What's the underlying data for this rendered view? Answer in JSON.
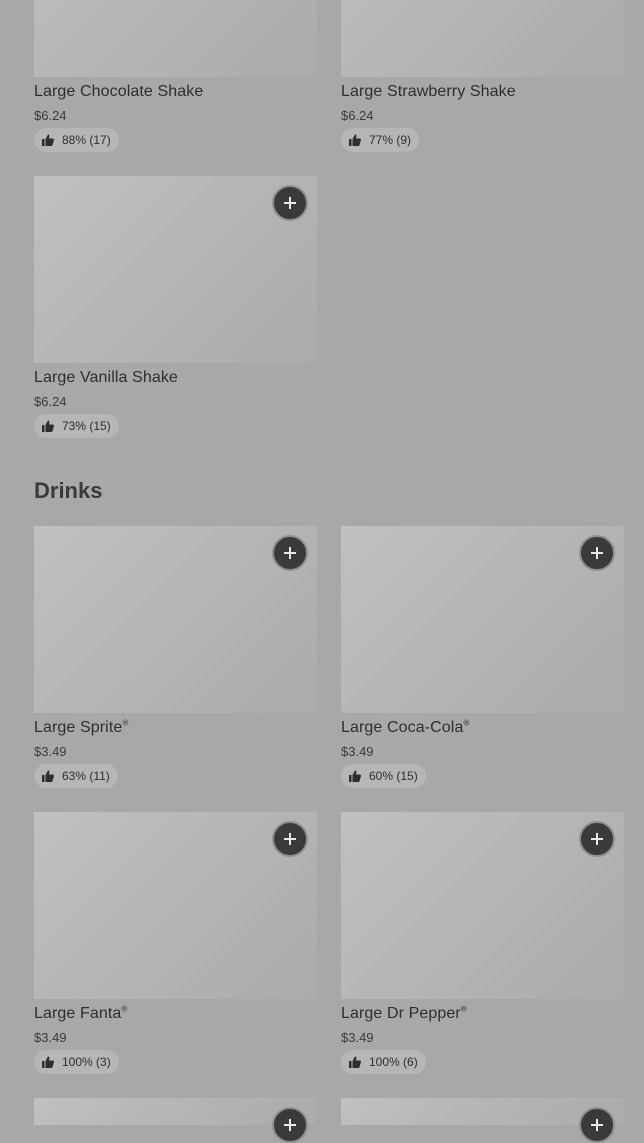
{
  "items_top": [
    {
      "name": "Large Chocolate Shake",
      "price": "$6.24",
      "rating": "88% (17)"
    },
    {
      "name": "Large Strawberry Shake",
      "price": "$6.24",
      "rating": "77% (9)"
    },
    {
      "name": "Large Vanilla Shake",
      "price": "$6.24",
      "rating": "73% (15)"
    }
  ],
  "drinks": {
    "title": "Drinks",
    "items": [
      {
        "name": "Large Sprite",
        "mark": "®",
        "price": "$3.49",
        "rating": "63% (11)"
      },
      {
        "name": "Large Coca-Cola",
        "mark": "®",
        "price": "$3.49",
        "rating": "60% (15)"
      },
      {
        "name": "Large Fanta",
        "mark": "®",
        "price": "$3.49",
        "rating": "100% (3)"
      },
      {
        "name": "Large Dr Pepper",
        "mark": "®",
        "price": "$3.49",
        "rating": "100% (6)"
      }
    ]
  },
  "icons": {
    "add": "plus-icon",
    "rating": "thumbs-up-icon"
  },
  "colors": {
    "overlay_bg": "#a8a8a8",
    "button_bg": "#3a3a3a",
    "text": "#2e2e2e"
  }
}
